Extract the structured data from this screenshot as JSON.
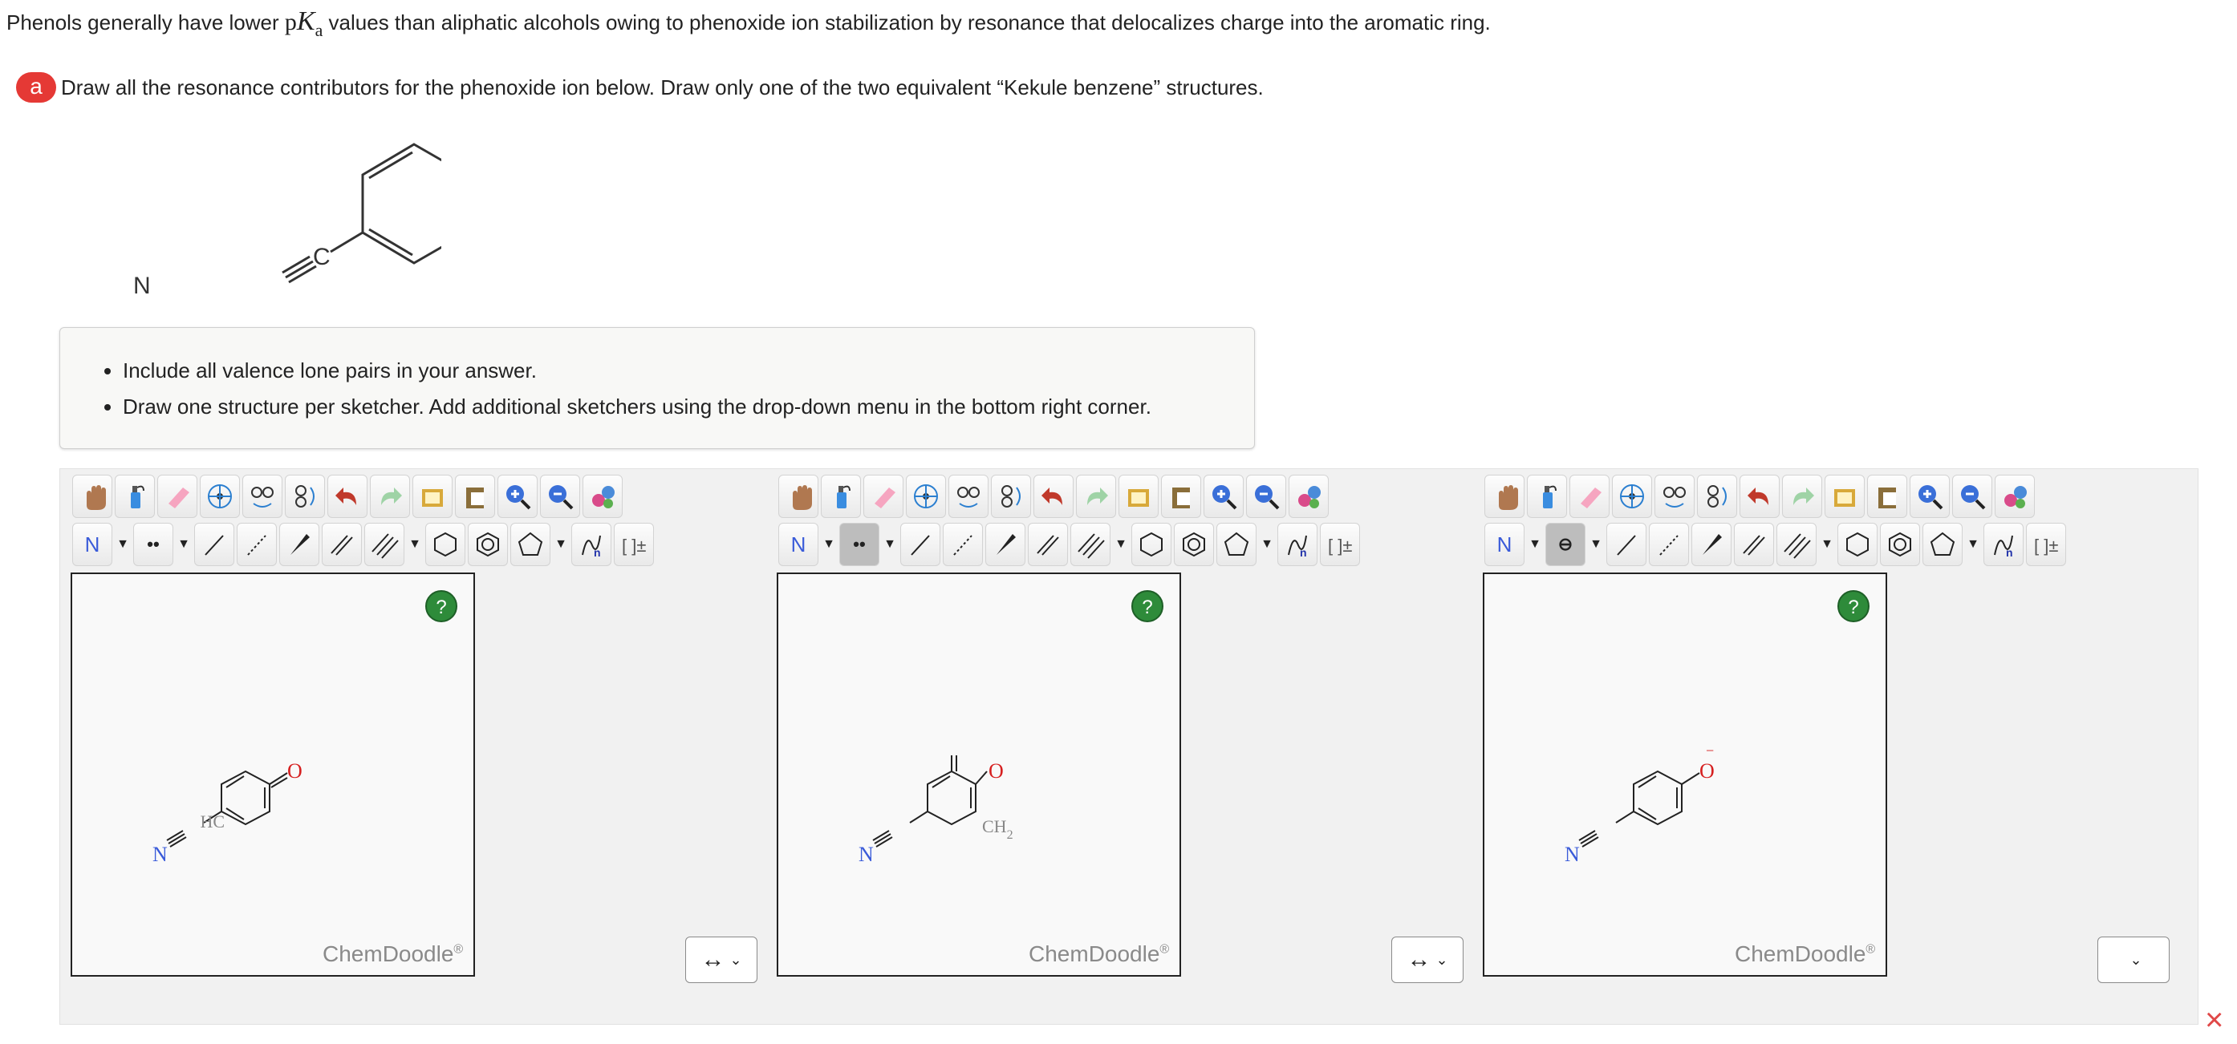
{
  "intro": {
    "before": "Phenols generally have lower ",
    "pka_p": "p",
    "pka_k": "K",
    "pka_a": "a",
    "after": " values than aliphatic alcohols owing to phenoxide ion stabilization by resonance that delocalizes charge into the aromatic ring."
  },
  "part": {
    "badge": "a",
    "text": "Draw all the resonance contributors for the phenoxide ion below. Draw only one of the two equivalent “Kekule benzene” structures."
  },
  "molecule": {
    "oxygen": "O",
    "charge": "−",
    "nitrogen": "N",
    "carbon": "C"
  },
  "hints": [
    "Include all valence lone pairs in your answer.",
    "Draw one structure per sketcher. Add additional sketchers using the drop-down menu in the bottom right corner."
  ],
  "sketchers": [
    {
      "atom_tool": "N",
      "charge_tool": "••",
      "help": "?",
      "logo": "ChemDoodle",
      "logo_mark": "®",
      "atoms": {
        "o": "O",
        "n": "N",
        "hc": "HC"
      }
    },
    {
      "atom_tool": "N",
      "charge_tool": "••",
      "help": "?",
      "logo": "ChemDoodle",
      "logo_mark": "®",
      "atoms": {
        "o": "O",
        "n": "N",
        "ch": "CH",
        "ch_sub": "2"
      }
    },
    {
      "atom_tool": "N",
      "charge_tool": "⊖",
      "help": "?",
      "logo": "ChemDoodle",
      "logo_mark": "®",
      "atoms": {
        "o": "O",
        "n": "N",
        "minus": "−"
      }
    }
  ],
  "selectors": [
    {
      "value": "↔",
      "chevron": "⌄"
    },
    {
      "value": "↔",
      "chevron": "⌄"
    },
    {
      "value": "",
      "chevron": "⌄"
    }
  ],
  "colors": {
    "badge": "#e53935",
    "atom_N": "#3a5bd9",
    "atom_O": "#d62020",
    "help": "#2e8b3a",
    "close": "#e04848"
  },
  "toolbar_icons_row1": [
    "hand-icon",
    "lasso-icon",
    "eraser-icon",
    "center-icon",
    "flip-horizontal-icon",
    "flip-vertical-icon",
    "undo-icon",
    "redo-icon",
    "template-icon",
    "paste-icon",
    "zoom-in-icon",
    "zoom-out-icon",
    "clean-icon"
  ],
  "toolbar_icons_row2": [
    "atom-label-icon",
    "charge-icon",
    "single-bond-icon",
    "dashed-bond-icon",
    "wedge-bond-icon",
    "double-bond-icon",
    "triple-bond-icon",
    "cyclohexane-icon",
    "benzene-icon",
    "cyclopentane-icon",
    "polymer-icon",
    "bracket-icon"
  ],
  "close_icon": "×"
}
